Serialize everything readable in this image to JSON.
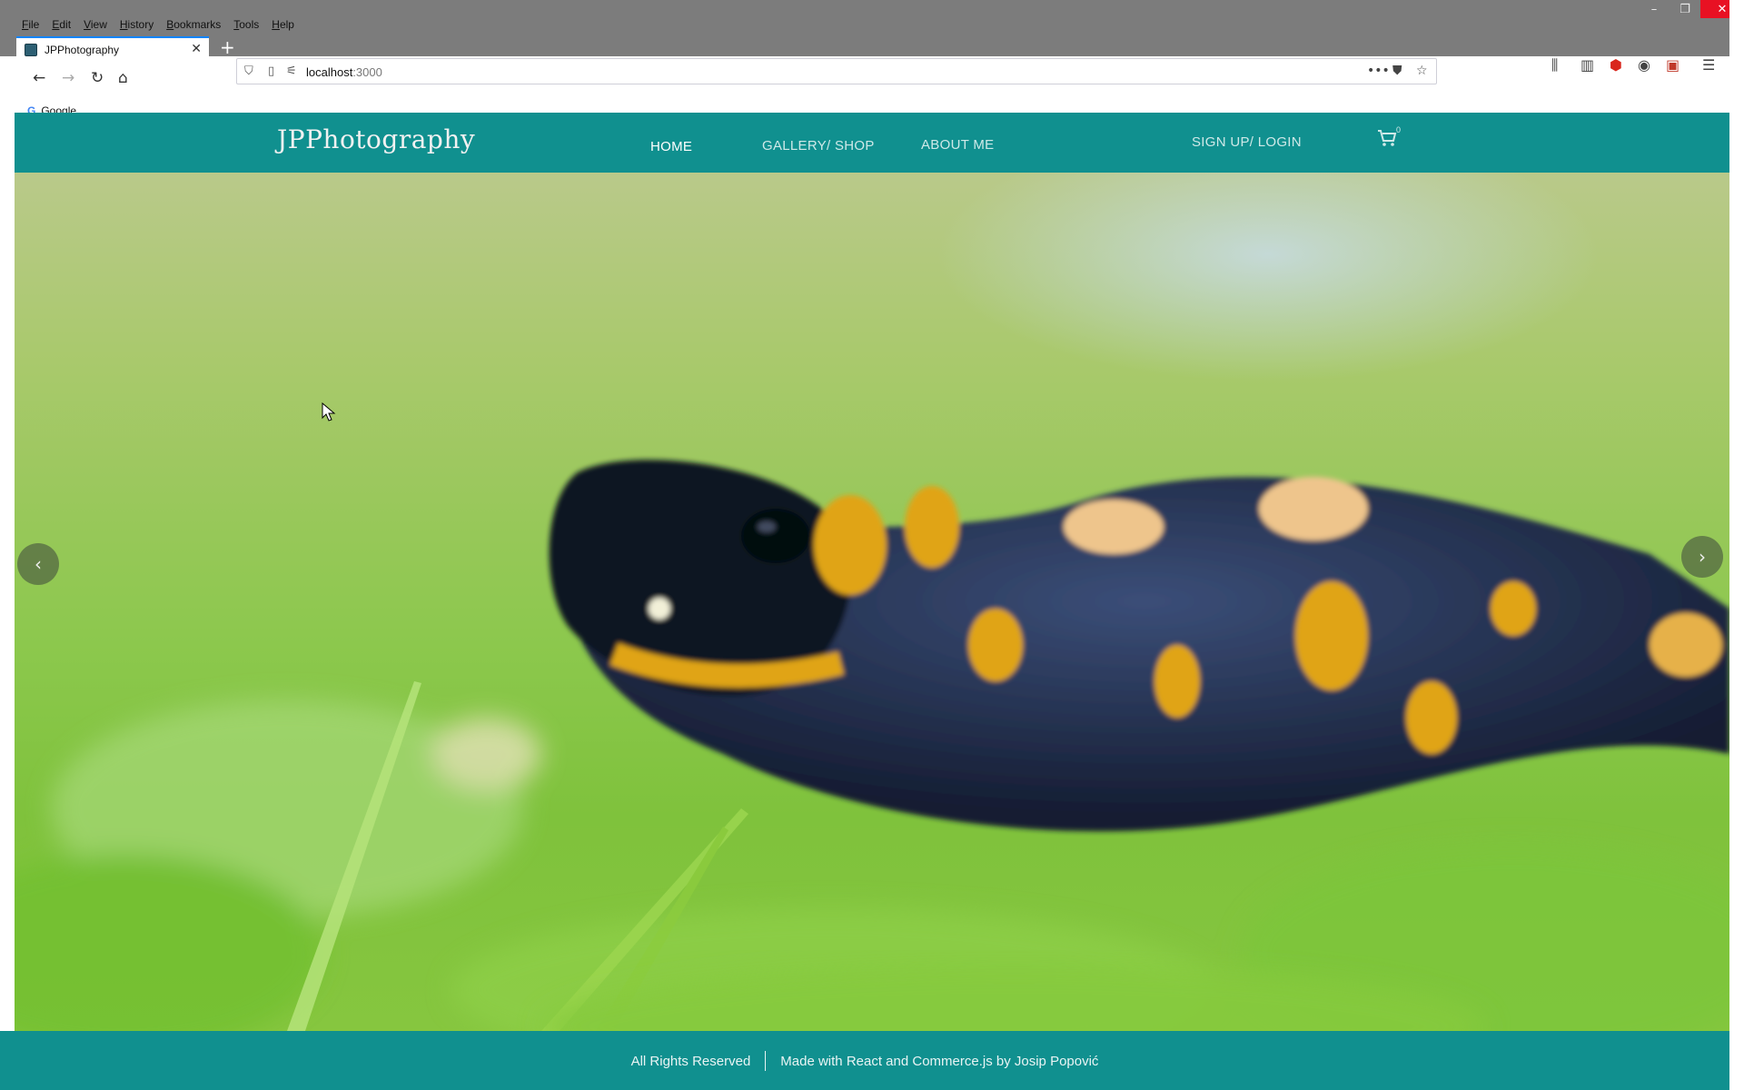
{
  "browser": {
    "menu": [
      "File",
      "Edit",
      "View",
      "History",
      "Bookmarks",
      "Tools",
      "Help"
    ],
    "tab_title": "JPPhotography",
    "url_host": "localhost",
    "url_port": ":3000",
    "bookmark": "Google",
    "icons": [
      "back-icon",
      "forward-icon",
      "reload-icon",
      "home-icon",
      "shield-icon",
      "page-icon",
      "permissions-icon",
      "more-icon",
      "pocket-icon",
      "star-icon",
      "library-icon",
      "sidebar-icon",
      "ublock-icon",
      "account-icon",
      "extension-icon",
      "menu-icon"
    ]
  },
  "site": {
    "logo": "JPPhotography",
    "nav": {
      "home": "HOME",
      "gallery": "GALLERY/ SHOP",
      "about": "ABOUT ME",
      "signup": "SIGN UP/ LOGIN"
    },
    "cart_count": "0",
    "accent_color": "#10908f"
  },
  "hero": {
    "prev_icon": "chevron-left-icon",
    "next_icon": "chevron-right-icon",
    "subject": "fire salamander on grass photo"
  },
  "footer": {
    "rights": "All Rights Reserved",
    "credit": "Made with React and Commerce.js by Josip Popović"
  }
}
